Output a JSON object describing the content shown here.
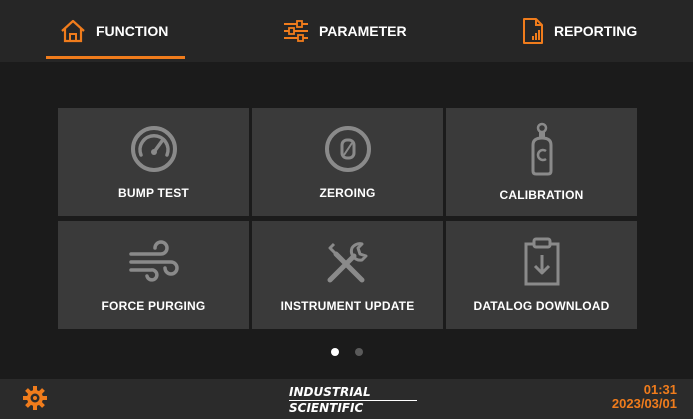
{
  "tabs": [
    {
      "label": "FUNCTION",
      "icon": "home-icon",
      "active": true
    },
    {
      "label": "PARAMETER",
      "icon": "sliders-icon",
      "active": false
    },
    {
      "label": "REPORTING",
      "icon": "report-icon",
      "active": false
    }
  ],
  "tiles": [
    {
      "label": "BUMP TEST",
      "icon": "gauge-icon"
    },
    {
      "label": "ZEROING",
      "icon": "zero-icon"
    },
    {
      "label": "CALIBRATION",
      "icon": "gas-cylinder-icon"
    },
    {
      "label": "FORCE PURGING",
      "icon": "wind-icon"
    },
    {
      "label": "INSTRUMENT UPDATE",
      "icon": "tools-icon"
    },
    {
      "label": "DATALOG DOWNLOAD",
      "icon": "clipboard-download-icon"
    }
  ],
  "pager": {
    "pages": 2,
    "current": 1
  },
  "footer": {
    "brand_line1": "INDUSTRIAL",
    "brand_line2": "SCIENTIFIC",
    "time": "01:31",
    "date": "2023/03/01",
    "settings_icon": "gear-icon"
  },
  "colors": {
    "accent": "#f07c1c",
    "tile": "#3a3a3a",
    "background": "#1b1b1b"
  }
}
